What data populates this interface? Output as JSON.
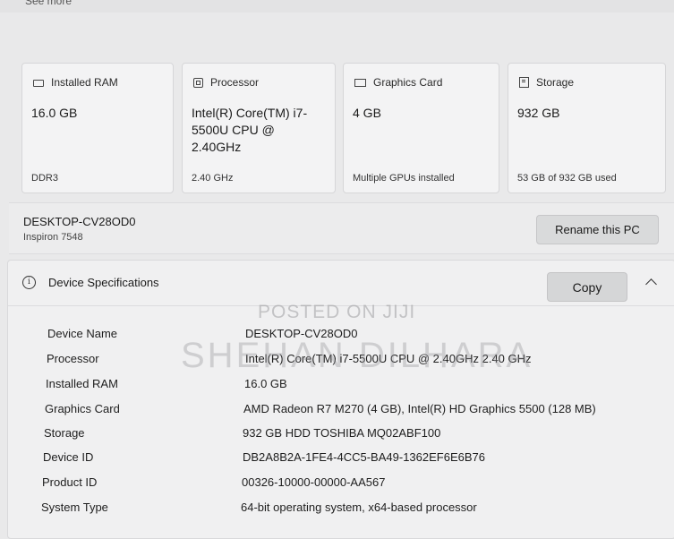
{
  "top_cut_text": "See more",
  "summary_cards": [
    {
      "title": "Installed RAM",
      "icon": "ram-icon",
      "value": "16.0 GB",
      "footer": "DDR3"
    },
    {
      "title": "Processor",
      "icon": "processor-icon",
      "value": "Intel(R) Core(TM) i7-5500U CPU @ 2.40GHz",
      "footer": "2.40 GHz"
    },
    {
      "title": "Graphics Card",
      "icon": "graphics-card-icon",
      "value": "4 GB",
      "footer": "Multiple GPUs installed"
    },
    {
      "title": "Storage",
      "icon": "storage-icon",
      "value": "932 GB",
      "footer": "53 GB of 932 GB used"
    }
  ],
  "pc": {
    "name": "DESKTOP-CV28OD0",
    "model": "Inspiron 7548",
    "rename_label": "Rename this PC"
  },
  "specs": {
    "title": "Device Specifications",
    "copy_label": "Copy",
    "rows": [
      {
        "label": "Device Name",
        "value": "DESKTOP-CV28OD0"
      },
      {
        "label": "Processor",
        "value": "Intel(R) Core(TM) i7-5500U CPU @ 2.40GHz   2.40 GHz"
      },
      {
        "label": "Installed RAM",
        "value": "16.0 GB"
      },
      {
        "label": "Graphics Card",
        "value": "AMD Radeon R7 M270 (4 GB), Intel(R) HD Graphics 5500 (128 MB)"
      },
      {
        "label": "Storage",
        "value": "932 GB HDD TOSHIBA MQ02ABF100"
      },
      {
        "label": "Device ID",
        "value": "DB2A8B2A-1FE4-4CC5-BA49-1362EF6E6B76"
      },
      {
        "label": "Product ID",
        "value": "00326-10000-00000-AA567"
      },
      {
        "label": "System Type",
        "value": "64-bit operating system, x64-based processor"
      }
    ]
  },
  "watermark": {
    "line1": "POSTED ON JIJI",
    "line2": "SHEHAN DILHARA"
  }
}
